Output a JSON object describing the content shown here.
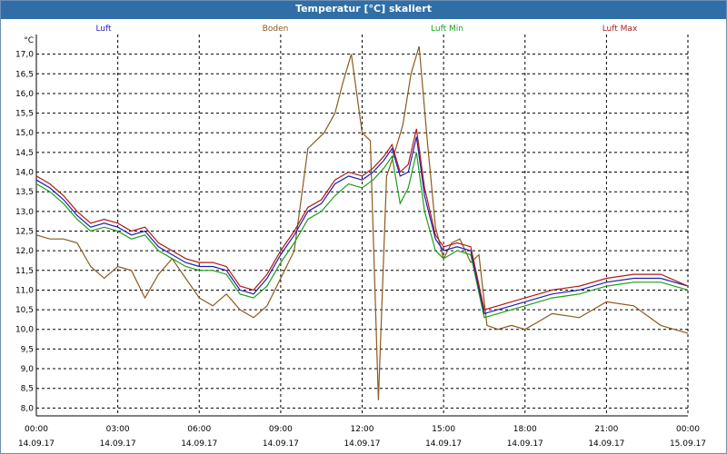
{
  "window": {
    "title": "Temperatur [°C] skaliert"
  },
  "chart_data": {
    "type": "line",
    "title": "Temperatur [°C] skaliert",
    "ylabel": "°C",
    "xlabel": "",
    "ylim": [
      7.8,
      17.5
    ],
    "xlim": [
      0,
      24
    ],
    "grid": true,
    "legend": "top",
    "y_ticks": [
      "8,0",
      "8,5",
      "9,0",
      "9,5",
      "10,0",
      "10,5",
      "11,0",
      "11,5",
      "12,0",
      "12,5",
      "13,0",
      "13,5",
      "14,0",
      "14,5",
      "15,0",
      "15,5",
      "16,0",
      "16,5",
      "17,0"
    ],
    "x_ticks": [
      {
        "time": "00:00",
        "date": "14.09.17"
      },
      {
        "time": "03:00",
        "date": "14.09.17"
      },
      {
        "time": "06:00",
        "date": "14.09.17"
      },
      {
        "time": "09:00",
        "date": "14.09.17"
      },
      {
        "time": "12:00",
        "date": "14.09.17"
      },
      {
        "time": "15:00",
        "date": "14.09.17"
      },
      {
        "time": "18:00",
        "date": "14.09.17"
      },
      {
        "time": "21:00",
        "date": "14.09.17"
      },
      {
        "time": "00:00",
        "date": "15.09.17"
      }
    ],
    "series": [
      {
        "name": "Luft",
        "color": "#1f1fb0",
        "x": [
          0,
          0.5,
          1,
          1.5,
          2,
          2.5,
          3,
          3.5,
          4,
          4.5,
          5,
          5.5,
          6,
          6.5,
          7,
          7.5,
          8,
          8.5,
          9,
          9.5,
          10,
          10.5,
          11,
          11.5,
          12,
          12.4,
          12.8,
          13.1,
          13.4,
          13.7,
          14,
          14.3,
          14.7,
          15,
          15.5,
          16,
          16.5,
          17,
          17.5,
          18,
          18.5,
          19,
          20,
          21,
          22,
          23,
          24
        ],
        "y": [
          13.8,
          13.6,
          13.3,
          12.9,
          12.6,
          12.7,
          12.6,
          12.4,
          12.5,
          12.1,
          11.9,
          11.7,
          11.6,
          11.6,
          11.5,
          11.0,
          10.9,
          11.3,
          11.9,
          12.4,
          13.0,
          13.2,
          13.7,
          13.9,
          13.8,
          14.0,
          14.3,
          14.6,
          13.9,
          14.0,
          14.9,
          13.4,
          12.3,
          12.0,
          12.1,
          12.0,
          10.4,
          10.5,
          10.6,
          10.7,
          10.8,
          10.9,
          11.0,
          11.2,
          11.3,
          11.3,
          11.1
        ]
      },
      {
        "name": "Boden",
        "color": "#8b5a1e",
        "x": [
          0,
          0.5,
          1,
          1.5,
          2,
          2.5,
          3,
          3.5,
          4,
          4.5,
          5,
          5.5,
          6,
          6.5,
          7,
          7.5,
          8,
          8.5,
          9,
          9.5,
          10,
          10.3,
          10.6,
          11,
          11.3,
          11.6,
          12,
          12.3,
          12.6,
          12.9,
          13.2,
          13.5,
          13.8,
          14.1,
          14.4,
          14.7,
          15,
          15.3,
          15.6,
          16,
          16.3,
          16.6,
          17,
          17.5,
          18,
          18.5,
          19,
          20,
          21,
          22,
          23,
          24
        ],
        "y": [
          12.4,
          12.3,
          12.3,
          12.2,
          11.6,
          11.3,
          11.6,
          11.5,
          10.8,
          11.4,
          11.8,
          11.3,
          10.8,
          10.6,
          10.9,
          10.5,
          10.3,
          10.6,
          11.3,
          12.0,
          14.6,
          14.8,
          15.0,
          15.5,
          16.3,
          17.0,
          15.0,
          14.8,
          8.2,
          13.9,
          14.5,
          15.2,
          16.5,
          17.2,
          14.8,
          12.6,
          11.8,
          12.2,
          12.3,
          11.7,
          11.9,
          10.1,
          10.0,
          10.1,
          10.0,
          10.2,
          10.4,
          10.3,
          10.7,
          10.6,
          10.1,
          9.9
        ]
      },
      {
        "name": "Luft Min",
        "color": "#1aa01a",
        "x": [
          0,
          0.5,
          1,
          1.5,
          2,
          2.5,
          3,
          3.5,
          4,
          4.5,
          5,
          5.5,
          6,
          6.5,
          7,
          7.5,
          8,
          8.5,
          9,
          9.5,
          10,
          10.5,
          11,
          11.5,
          12,
          12.4,
          12.8,
          13.1,
          13.4,
          13.7,
          14,
          14.3,
          14.7,
          15,
          15.5,
          16,
          16.5,
          17,
          17.5,
          18,
          18.5,
          19,
          20,
          21,
          22,
          23,
          24
        ],
        "y": [
          13.7,
          13.5,
          13.2,
          12.8,
          12.5,
          12.6,
          12.5,
          12.3,
          12.4,
          12.0,
          11.8,
          11.6,
          11.5,
          11.5,
          11.4,
          10.9,
          10.8,
          11.1,
          11.7,
          12.2,
          12.8,
          13.0,
          13.4,
          13.7,
          13.6,
          13.8,
          14.1,
          14.4,
          13.2,
          13.6,
          14.5,
          13.0,
          12.0,
          11.8,
          12.0,
          11.9,
          10.3,
          10.4,
          10.5,
          10.6,
          10.7,
          10.8,
          10.9,
          11.1,
          11.2,
          11.2,
          11.0
        ]
      },
      {
        "name": "Luft Max",
        "color": "#b01a1a",
        "x": [
          0,
          0.5,
          1,
          1.5,
          2,
          2.5,
          3,
          3.5,
          4,
          4.5,
          5,
          5.5,
          6,
          6.5,
          7,
          7.5,
          8,
          8.5,
          9,
          9.5,
          10,
          10.5,
          11,
          11.5,
          12,
          12.4,
          12.8,
          13.1,
          13.4,
          13.7,
          14,
          14.3,
          14.7,
          15,
          15.5,
          16,
          16.5,
          17,
          17.5,
          18,
          18.5,
          19,
          20,
          21,
          22,
          23,
          24
        ],
        "y": [
          13.9,
          13.7,
          13.4,
          13.0,
          12.7,
          12.8,
          12.7,
          12.5,
          12.6,
          12.2,
          12.0,
          11.8,
          11.7,
          11.7,
          11.6,
          11.1,
          11.0,
          11.4,
          12.0,
          12.5,
          13.1,
          13.3,
          13.8,
          14.0,
          13.9,
          14.1,
          14.4,
          14.7,
          14.0,
          14.2,
          15.1,
          13.6,
          12.4,
          12.1,
          12.2,
          12.1,
          10.5,
          10.6,
          10.7,
          10.8,
          10.9,
          11.0,
          11.1,
          11.3,
          11.4,
          11.4,
          11.1
        ]
      }
    ]
  }
}
